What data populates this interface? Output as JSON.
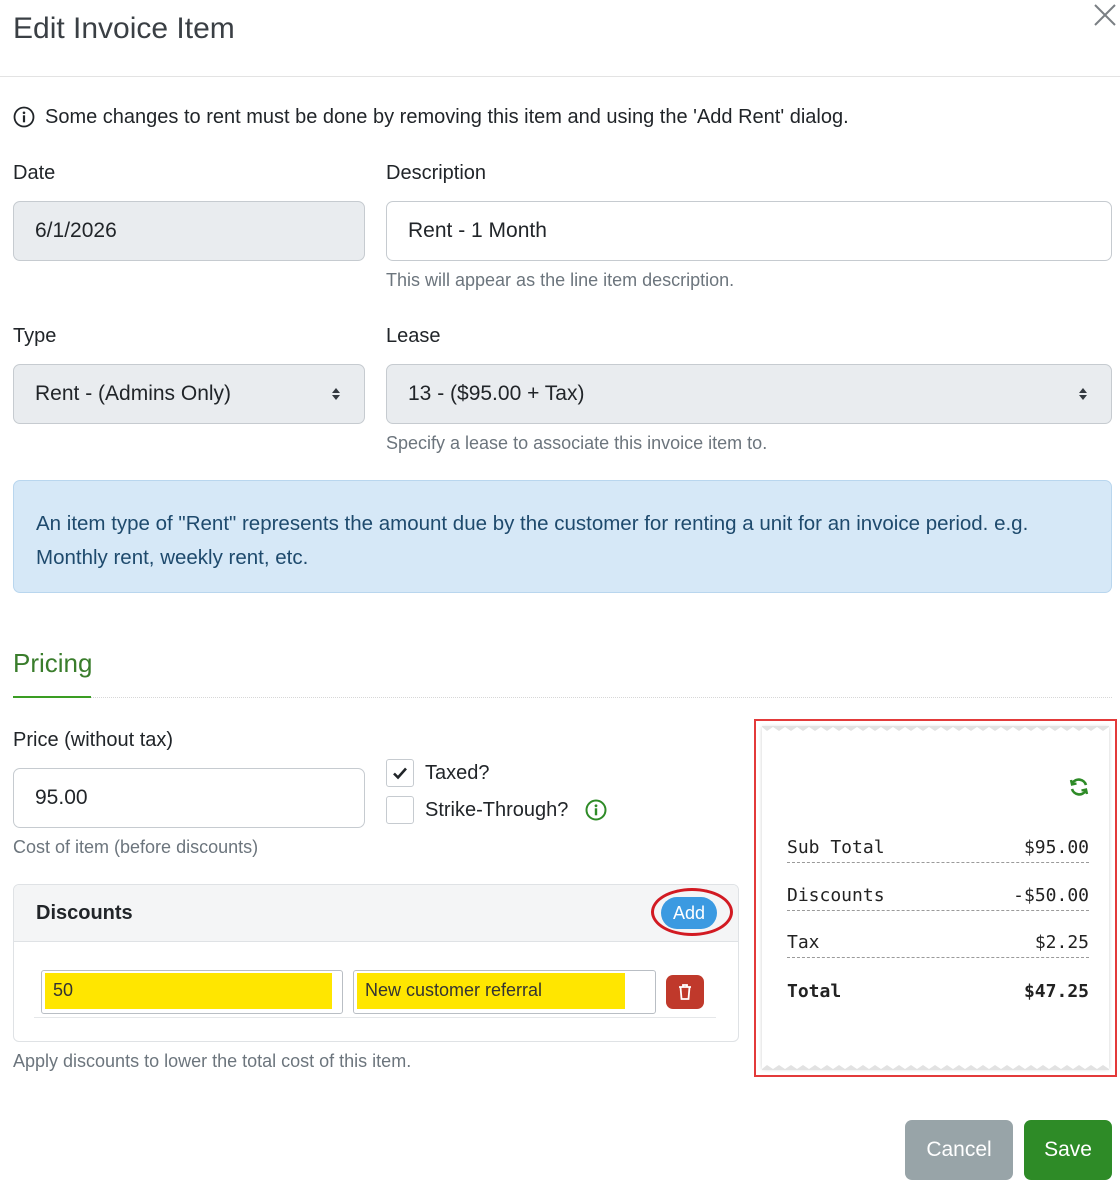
{
  "header": {
    "title": "Edit Invoice Item"
  },
  "notice": {
    "text": "Some changes to rent must be done by removing this item and using the 'Add Rent' dialog."
  },
  "date": {
    "label": "Date",
    "value": "6/1/2026"
  },
  "description": {
    "label": "Description",
    "value": "Rent - 1 Month",
    "help": "This will appear as the line item description."
  },
  "type": {
    "label": "Type",
    "selected": "Rent - (Admins Only)"
  },
  "lease": {
    "label": "Lease",
    "selected": "13 - ($95.00 + Tax)",
    "help": "Specify a lease to associate this invoice item to."
  },
  "info_alert": {
    "text": "An item type of \"Rent\" represents the amount due by the customer for renting a unit for an invoice period. e.g. Monthly rent, weekly rent, etc."
  },
  "pricing": {
    "title": "Pricing",
    "price_label": "Price (without tax)",
    "price_value": "95.00",
    "price_help": "Cost of item (before discounts)",
    "taxed_label": "Taxed?",
    "taxed_checked": true,
    "strike_label": "Strike-Through?",
    "strike_checked": false
  },
  "discounts": {
    "title": "Discounts",
    "add_label": "Add",
    "rows": [
      {
        "amount": "50",
        "reason": "New customer referral"
      }
    ],
    "help": "Apply discounts to lower the total cost of this item."
  },
  "summary": {
    "subtotal_label": "Sub Total",
    "subtotal_value": "$95.00",
    "discounts_label": "Discounts",
    "discounts_value": "-$50.00",
    "tax_label": "Tax",
    "tax_value": "$2.25",
    "total_label": "Total",
    "total_value": "$47.25"
  },
  "footer": {
    "cancel_label": "Cancel",
    "save_label": "Save"
  },
  "colors": {
    "primary_green": "#2e8b27",
    "info_blue": "#3b9ae1",
    "danger_red": "#c0392b",
    "highlight_yellow": "#ffe600",
    "annotation_red": "#d21a22"
  }
}
